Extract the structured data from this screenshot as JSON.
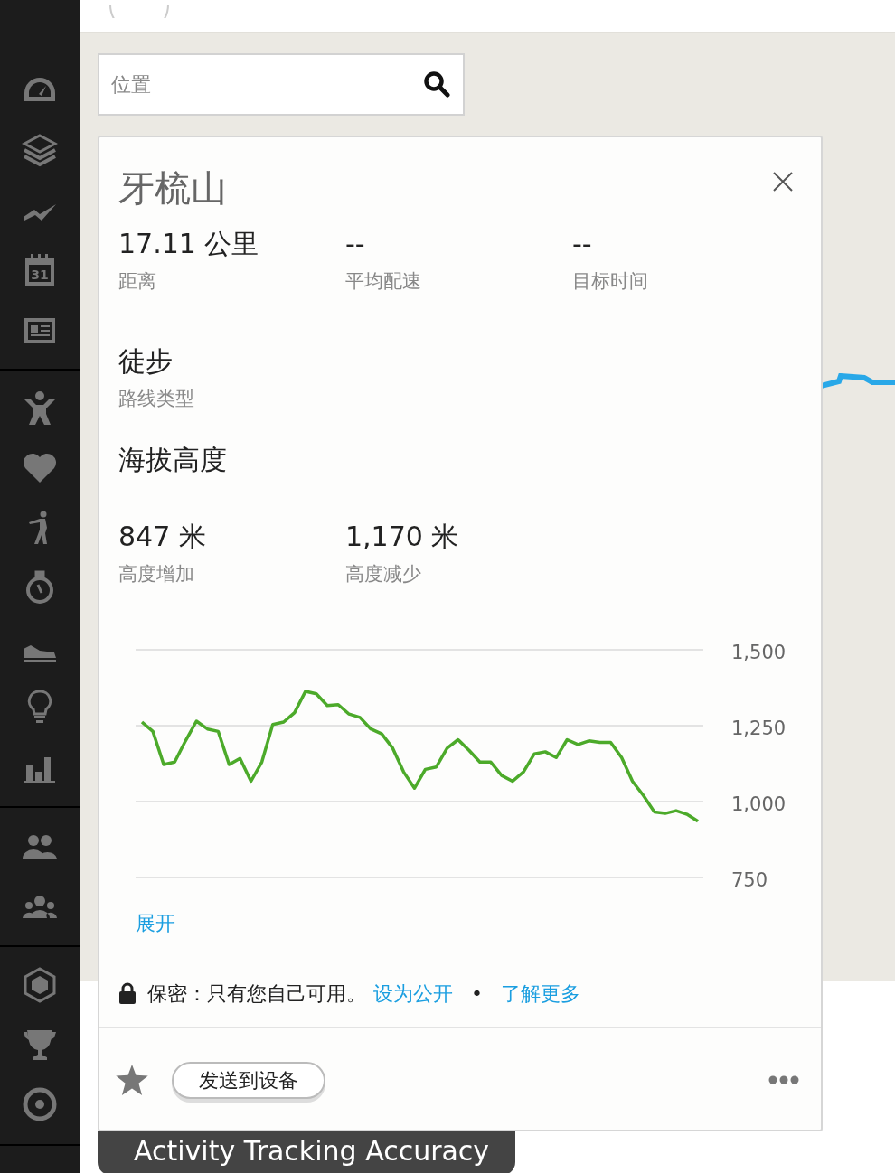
{
  "sidebar": {
    "calendar_day": "31"
  },
  "search": {
    "placeholder": "位置"
  },
  "route": {
    "title": "牙梳山",
    "stats": [
      {
        "value": "17.11 公里",
        "label": "距离"
      },
      {
        "value": "--",
        "label": "平均配速"
      },
      {
        "value": "--",
        "label": "目标时间"
      }
    ],
    "route_type": {
      "value": "徒步",
      "label": "路线类型"
    },
    "elevation": {
      "title": "海拔高度",
      "stats": [
        {
          "value": "847 米",
          "label": "高度增加"
        },
        {
          "value": "1,170 米",
          "label": "高度减少"
        }
      ],
      "chart_data": {
        "type": "line",
        "ylim": [
          750,
          1500
        ],
        "yticks": [
          {
            "value": 750,
            "label": "750"
          },
          {
            "value": 1000,
            "label": "1,000"
          },
          {
            "value": 1250,
            "label": "1,250"
          },
          {
            "value": 1500,
            "label": "1,500"
          }
        ],
        "series": [
          {
            "color": "#4caa2a",
            "values": [
              1262,
              1231,
              1122,
              1130,
              1200,
              1265,
              1239,
              1231,
              1122,
              1142,
              1067,
              1130,
              1254,
              1262,
              1293,
              1363,
              1355,
              1316,
              1319,
              1288,
              1277,
              1239,
              1223,
              1176,
              1098,
              1044,
              1106,
              1114,
              1176,
              1204,
              1169,
              1130,
              1130,
              1086,
              1067,
              1098,
              1157,
              1164,
              1145,
              1204,
              1188,
              1200,
              1195,
              1195,
              1145,
              1067,
              1020,
              966,
              961,
              970,
              958,
              935
            ]
          }
        ]
      }
    },
    "expand_link": "展开",
    "privacy": {
      "text": "保密：只有您自己可用。",
      "make_public_link": "设为公开",
      "separator": "•",
      "learn_more_link": "了解更多"
    },
    "send_button": "发送到设备"
  },
  "banner": "Activity Tracking Accuracy"
}
